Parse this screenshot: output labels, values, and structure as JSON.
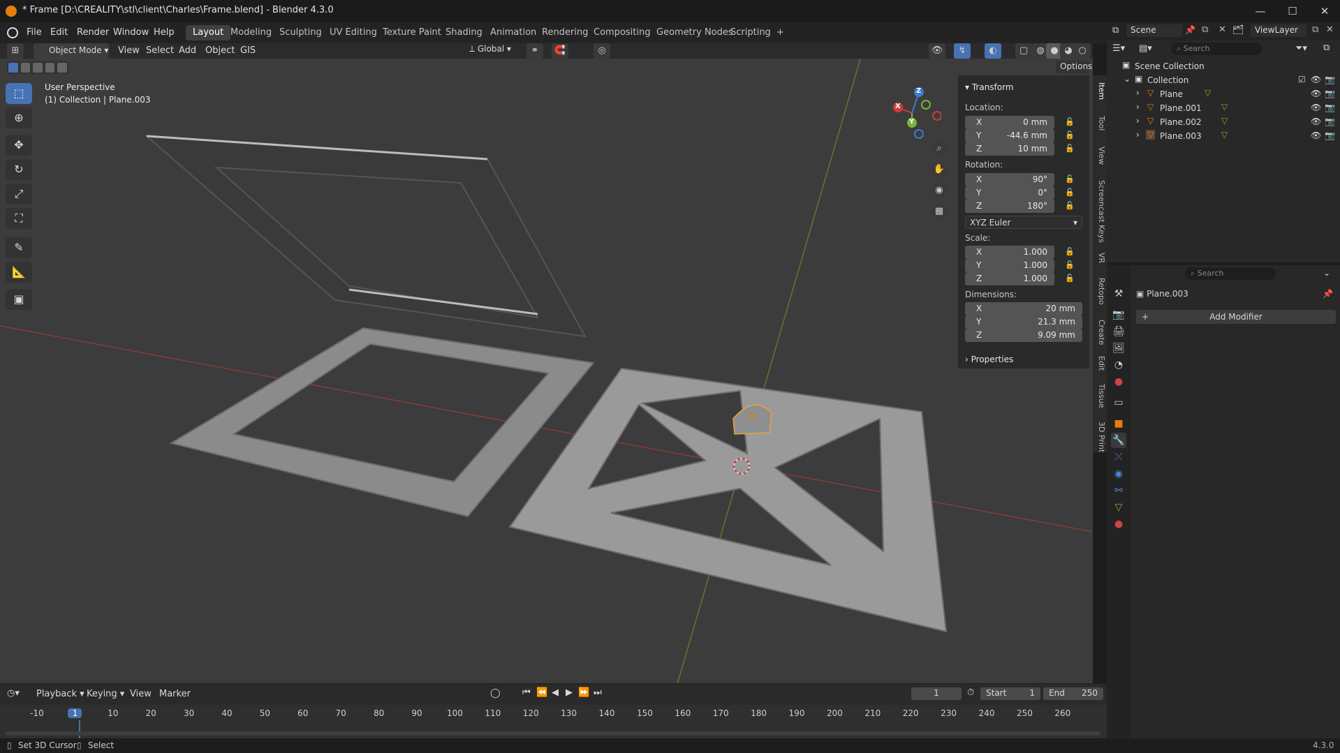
{
  "window": {
    "title": "* Frame [D:\\CREALITY\\stl\\client\\Charles\\Frame.blend] - Blender 4.3.0",
    "min": "—",
    "max": "☐",
    "close": "✕"
  },
  "menu": [
    "File",
    "Edit",
    "Render",
    "Window",
    "Help"
  ],
  "workspaces": [
    "Layout",
    "Modeling",
    "Sculpting",
    "UV Editing",
    "Texture Paint",
    "Shading",
    "Animation",
    "Rendering",
    "Compositing",
    "Geometry Nodes",
    "Scripting"
  ],
  "add_workspace": "+",
  "viewport_header": {
    "mode": "Object Mode",
    "menus": [
      "View",
      "Select",
      "Add",
      "Object",
      "GIS"
    ],
    "orientation": "Global",
    "options": "Options"
  },
  "overlay_text": {
    "perspective": "User Perspective",
    "context": "(1) Collection | Plane.003"
  },
  "gizmo": {
    "x": "X",
    "y": "Y",
    "z": "Z"
  },
  "npanel": {
    "section": "Transform",
    "location_label": "Location:",
    "location": [
      {
        "axis": "X",
        "value": "0 mm"
      },
      {
        "axis": "Y",
        "value": "-44.6 mm"
      },
      {
        "axis": "Z",
        "value": "10 mm"
      }
    ],
    "rotation_label": "Rotation:",
    "rotation": [
      {
        "axis": "X",
        "value": "90°"
      },
      {
        "axis": "Y",
        "value": "0°"
      },
      {
        "axis": "Z",
        "value": "180°"
      }
    ],
    "rotation_mode": "XYZ Euler",
    "scale_label": "Scale:",
    "scale": [
      {
        "axis": "X",
        "value": "1.000"
      },
      {
        "axis": "Y",
        "value": "1.000"
      },
      {
        "axis": "Z",
        "value": "1.000"
      }
    ],
    "dimensions_label": "Dimensions:",
    "dimensions": [
      {
        "axis": "X",
        "value": "20 mm"
      },
      {
        "axis": "Y",
        "value": "21.3 mm"
      },
      {
        "axis": "Z",
        "value": "9.09 mm"
      }
    ],
    "properties": "Properties"
  },
  "sidebar_tabs": [
    "Item",
    "Tool",
    "View",
    "Screencast Keys",
    "VR",
    "Retopo",
    "Create",
    "Edit",
    "Tissue",
    "3D Print"
  ],
  "topright": {
    "scene": "Scene",
    "viewlayer": "ViewLayer"
  },
  "outliner": {
    "search_placeholder": "Search",
    "scene_collection": "Scene Collection",
    "collection": "Collection",
    "objects": [
      "Plane",
      "Plane.001",
      "Plane.002",
      "Plane.003"
    ]
  },
  "properties": {
    "search_placeholder": "Search",
    "object": "Plane.003",
    "add_modifier": "Add Modifier"
  },
  "timeline": {
    "menus": [
      "Playback",
      "Keying",
      "View",
      "Marker"
    ],
    "current_frame": "1",
    "start_label": "Start",
    "start": "1",
    "end_label": "End",
    "end": "250",
    "ticks": [
      "-10",
      "1",
      "10",
      "20",
      "30",
      "40",
      "50",
      "60",
      "70",
      "80",
      "90",
      "100",
      "110",
      "120",
      "130",
      "140",
      "150",
      "160",
      "170",
      "180",
      "190",
      "200",
      "210",
      "220",
      "230",
      "240",
      "250",
      "260"
    ]
  },
  "status": {
    "left1": "Set 3D Cursor",
    "left2": "Select",
    "version": "4.3.0"
  },
  "colors": {
    "accent": "#4772b3",
    "x_axis": "#d03b3b",
    "y_axis": "#7ab33a",
    "z_axis": "#3a7ad0",
    "orange": "#e87d0d"
  }
}
